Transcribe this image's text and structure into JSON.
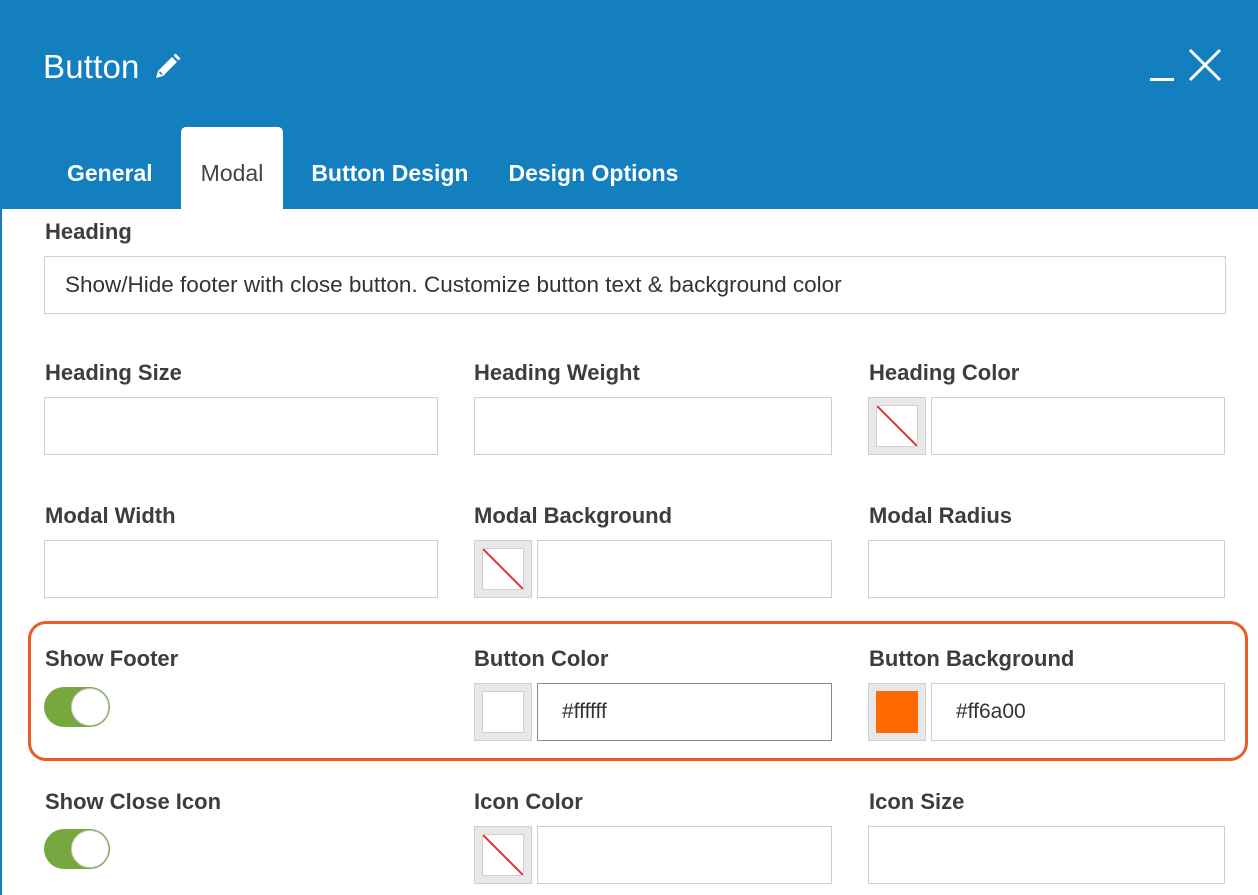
{
  "header": {
    "title": "Button",
    "pencil_icon": "pencil-icon",
    "minimize_icon": "minimize-icon",
    "close_icon": "close-icon",
    "background": "#137fbf"
  },
  "tabs": [
    {
      "label": "General",
      "active": false
    },
    {
      "label": "Modal",
      "active": true
    },
    {
      "label": "Button Design",
      "active": false
    },
    {
      "label": "Design Options",
      "active": false
    }
  ],
  "form": {
    "heading": {
      "label": "Heading",
      "value": "Show/Hide footer with close button. Customize button text & background color"
    },
    "heading_size": {
      "label": "Heading Size",
      "value": ""
    },
    "heading_weight": {
      "label": "Heading Weight",
      "value": ""
    },
    "heading_color": {
      "label": "Heading Color",
      "value": ""
    },
    "modal_width": {
      "label": "Modal Width",
      "value": ""
    },
    "modal_background": {
      "label": "Modal Background",
      "value": ""
    },
    "modal_radius": {
      "label": "Modal Radius",
      "value": ""
    },
    "show_footer": {
      "label": "Show Footer",
      "enabled": true
    },
    "button_color": {
      "label": "Button Color",
      "value": "#ffffff",
      "swatch": "#ffffff"
    },
    "button_background": {
      "label": "Button Background",
      "value": "#ff6a00",
      "swatch": "#ff6a00"
    },
    "show_close_icon": {
      "label": "Show Close Icon",
      "enabled": true
    },
    "icon_color": {
      "label": "Icon Color",
      "value": ""
    },
    "icon_size": {
      "label": "Icon Size",
      "value": ""
    }
  },
  "colors": {
    "toggle_on": "#77a840",
    "highlight": "#eb5b23",
    "no_color_slash": "#e0302f"
  }
}
